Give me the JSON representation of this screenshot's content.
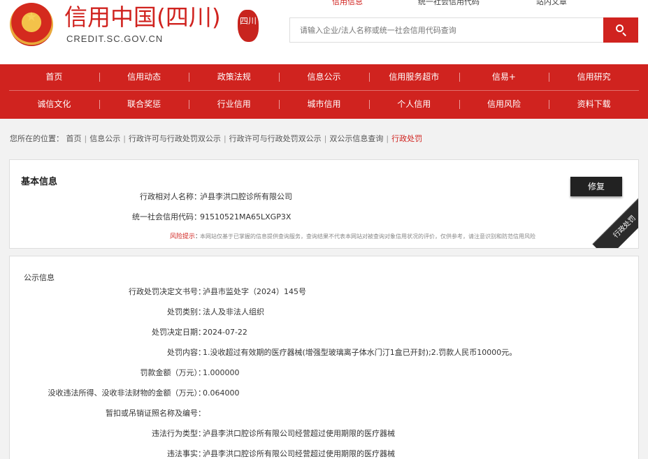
{
  "header": {
    "brand_cn": "信用中国(四川)",
    "brand_en": "CREDIT.SC.GOV.CN",
    "seal_text": "四川",
    "top_links": [
      "信用信息",
      "统一社会信用代码",
      "站内文章"
    ],
    "active_link": "信用信息",
    "search_placeholder": "请输入企业/法人名称或统一社会信用代码查询",
    "accent_color": "#d0231f"
  },
  "nav": {
    "row1": [
      "首页",
      "信用动态",
      "政策法规",
      "信息公示",
      "信用服务超市",
      "信易+",
      "信用研究"
    ],
    "row2": [
      "诚信文化",
      "联合奖惩",
      "行业信用",
      "城市信用",
      "个人信用",
      "信用风险",
      "资料下载"
    ]
  },
  "breadcrumb": {
    "prefix": "您所在的位置：",
    "items": [
      "首页",
      "信息公示",
      "行政许可与行政处罚双公示",
      "行政许可与行政处罚双公示",
      "双公示信息查询",
      "行政处罚"
    ]
  },
  "basic_info": {
    "title": "基本信息",
    "repair_label": "修复",
    "ribbon_label": "行政处罚",
    "fields": [
      {
        "label": "行政相对人名称：",
        "value": "泸县李洪口腔诊所有限公司"
      },
      {
        "label": "统一社会信用代码：",
        "value": "91510521MA65LXGP3X"
      }
    ],
    "risk_label": "风险提示",
    "risk_colon": "：",
    "risk_text": "本网站仅基于已掌握的信息提供查询服务，查询结果不代表本网站对被查询对象信用状况的评价，仅供参考，请注意识别和防范信用风险"
  },
  "public_info": {
    "title": "公示信息",
    "fields": [
      {
        "label": "行政处罚决定文书号：",
        "value": "泸县市监处字（2024）145号"
      },
      {
        "label": "处罚类别：",
        "value": "法人及非法人组织"
      },
      {
        "label": "处罚决定日期：",
        "value": "2024-07-22"
      },
      {
        "label": "处罚内容：",
        "value": "1.没收超过有效期的医疗器械(增强型玻璃离子体水门汀1盒已开封);2.罚款人民币10000元。"
      },
      {
        "label": "罚款金额（万元）：",
        "value": "1.000000"
      },
      {
        "label": "没收违法所得、没收非法财物的金额（万元）：",
        "value": "0.064000"
      },
      {
        "label": "暂扣或吊销证照名称及编号：",
        "value": ""
      },
      {
        "label": "违法行为类型：",
        "value": "泸县李洪口腔诊所有限公司经营超过使用期限的医疗器械"
      },
      {
        "label": "违法事实：",
        "value": "泸县李洪口腔诊所有限公司经营超过使用期限的医疗器械"
      }
    ]
  }
}
